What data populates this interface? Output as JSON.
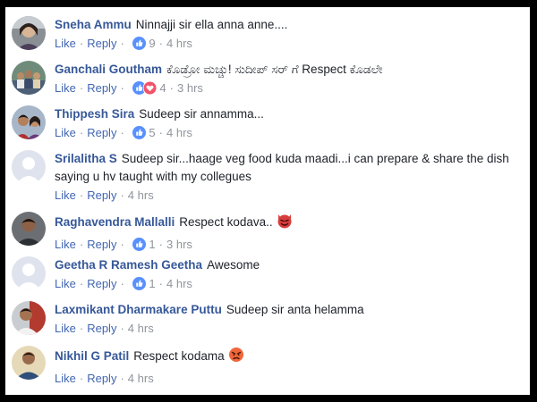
{
  "ui": {
    "like_label": "Like",
    "reply_label": "Reply",
    "separator": "·"
  },
  "comments": [
    {
      "author": "Sneha Ammu",
      "text": "Ninnajji sir ella anna anne....",
      "reactions": [
        "like-icon"
      ],
      "reaction_count": "9",
      "time": "4 hrs",
      "avatar": "avatar-photo-woman"
    },
    {
      "author": "Ganchali Goutham",
      "text": "ಕೊಡ್ರೋ ಮಚ್ಚು! ಸುದೀಪ್ ಸರ್ ಗೆ Respect ಕೊಡಲೇ",
      "reactions": [
        "like-icon",
        "love-icon"
      ],
      "reaction_count": "4",
      "time": "3 hrs",
      "avatar": "avatar-photo-group"
    },
    {
      "author": "Thippesh Sira",
      "text": "Sudeep sir annamma...",
      "reactions": [
        "like-icon"
      ],
      "reaction_count": "5",
      "time": "4 hrs",
      "avatar": "avatar-photo-couple"
    },
    {
      "author": "Srilalitha S",
      "text": "Sudeep sir...haage veg food kuda maadi...i can prepare & share the dish saying u hv taught with my collegues",
      "reactions": [],
      "reaction_count": "",
      "time": "4 hrs",
      "avatar": "default-avatar"
    },
    {
      "author": "Raghavendra Mallalli",
      "text": "Respect kodava..",
      "emoji": "devil-emoji-icon",
      "reactions": [
        "like-icon"
      ],
      "reaction_count": "1",
      "time": "3 hrs",
      "avatar": "avatar-photo-man"
    },
    {
      "author": "Geetha R Ramesh Geetha",
      "text": "Awesome",
      "reactions": [
        "like-icon"
      ],
      "reaction_count": "1",
      "time": "4 hrs",
      "avatar": "default-avatar"
    },
    {
      "author": "Laxmikant Dharmakare Puttu",
      "text": "Sudeep sir anta helamma",
      "reactions": [],
      "reaction_count": "",
      "time": "4 hrs",
      "avatar": "avatar-photo-man2"
    },
    {
      "author": "Nikhil G Patil",
      "text": "Respect kodama",
      "emoji": "angry-emoji-icon",
      "reactions": [],
      "reaction_count": "",
      "time": "4 hrs",
      "avatar": "avatar-photo-man3"
    }
  ],
  "colors": {
    "author_link": "#365899",
    "action_link": "#4267b2",
    "meta_text": "#90949c",
    "like_blue": "#5890ff",
    "love_red": "#f25268",
    "emoji_devil": "#d73d3d",
    "emoji_angry": "#f0663a"
  }
}
